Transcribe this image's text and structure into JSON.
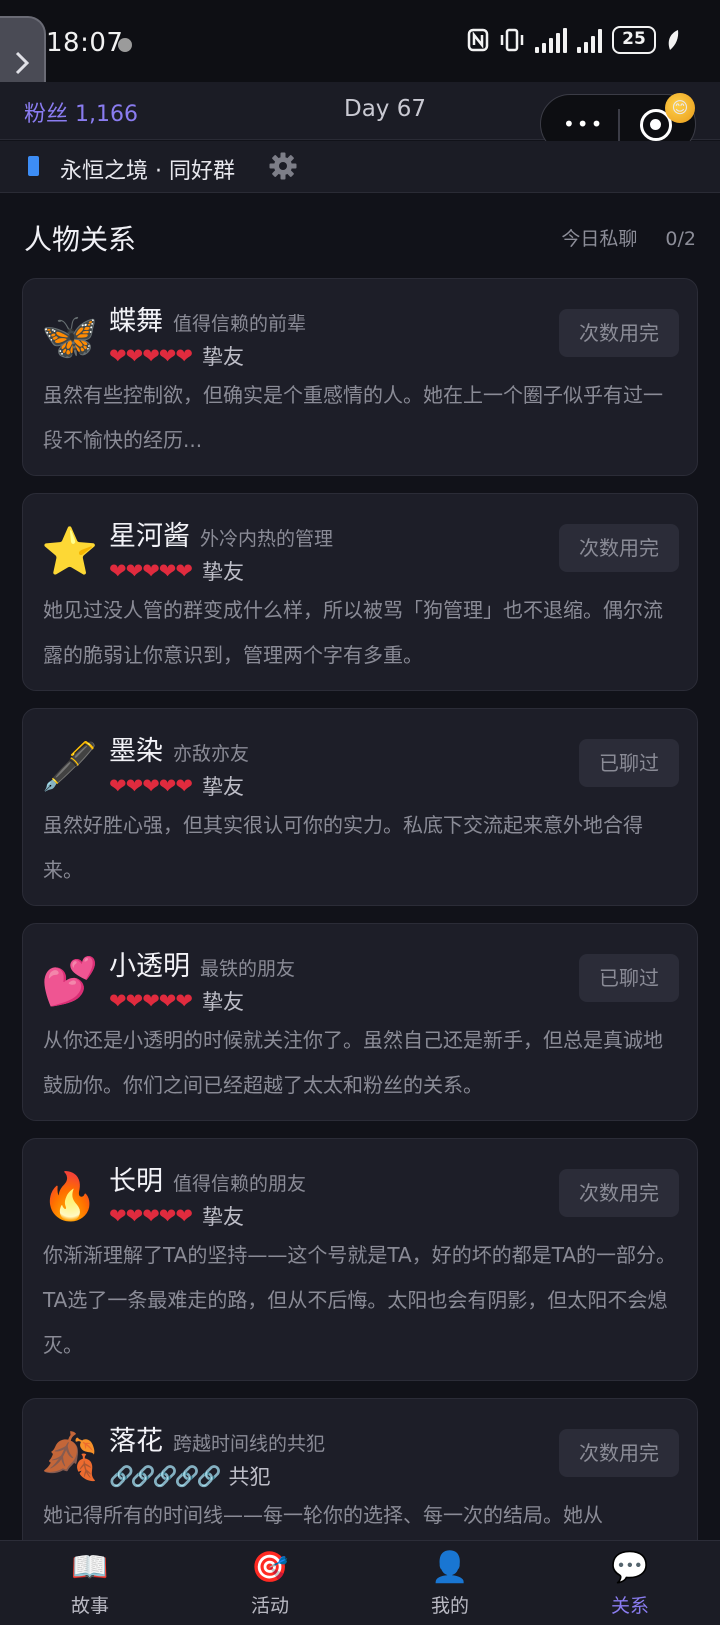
{
  "status": {
    "time": "18:07",
    "battery": "25"
  },
  "header": {
    "fans": "粉丝 1,166",
    "day": "Day 67",
    "capsule_dots": "•••"
  },
  "group": {
    "name": "永恒之境 · 同好群"
  },
  "section": {
    "title": "人物关系",
    "chat_label": "今日私聊",
    "chat_count": "0/2"
  },
  "cards": [
    {
      "avatar": "🦋",
      "name": "蝶舞",
      "title": "值得信赖的前辈",
      "marks": "❤❤❤❤❤",
      "relation": "挚友",
      "button": "次数用完",
      "desc": "虽然有些控制欲，但确实是个重感情的人。她在上一个圈子似乎有过一段不愉快的经历..."
    },
    {
      "avatar": "⭐",
      "name": "星河酱",
      "title": "外冷内热的管理",
      "marks": "❤❤❤❤❤",
      "relation": "挚友",
      "button": "次数用完",
      "desc": "她见过没人管的群变成什么样，所以被骂「狗管理」也不退缩。偶尔流露的脆弱让你意识到，管理两个字有多重。"
    },
    {
      "avatar": "🖋️",
      "name": "墨染",
      "title": "亦敌亦友",
      "marks": "❤❤❤❤❤",
      "relation": "挚友",
      "button": "已聊过",
      "desc": "虽然好胜心强，但其实很认可你的实力。私底下交流起来意外地合得来。"
    },
    {
      "avatar": "💕",
      "name": "小透明",
      "title": "最铁的朋友",
      "marks": "❤❤❤❤❤",
      "relation": "挚友",
      "button": "已聊过",
      "desc": "从你还是小透明的时候就关注你了。虽然自己还是新手，但总是真诚地鼓励你。你们之间已经超越了太太和粉丝的关系。"
    },
    {
      "avatar": "🔥",
      "name": "长明",
      "title": "值得信赖的朋友",
      "marks": "❤❤❤❤❤",
      "relation": "挚友",
      "button": "次数用完",
      "desc": "你渐渐理解了TA的坚持——这个号就是TA，好的坏的都是TA的一部分。TA选了一条最难走的路，但从不后悔。太阳也会有阴影，但太阳不会熄灭。"
    },
    {
      "avatar": "🍂",
      "name": "落花",
      "title": "跨越时间线的共犯",
      "marks": "🔗🔗🔗🔗🔗",
      "relation": "共犯",
      "button": "次数用完",
      "desc": "她记得所有的时间线——每一轮你的选择、每一次的结局。她从"
    }
  ],
  "nav": [
    {
      "icon": "📖",
      "label": "故事"
    },
    {
      "icon": "🎯",
      "label": "活动"
    },
    {
      "icon": "👤",
      "label": "我的"
    },
    {
      "icon": "💬",
      "label": "关系"
    }
  ]
}
